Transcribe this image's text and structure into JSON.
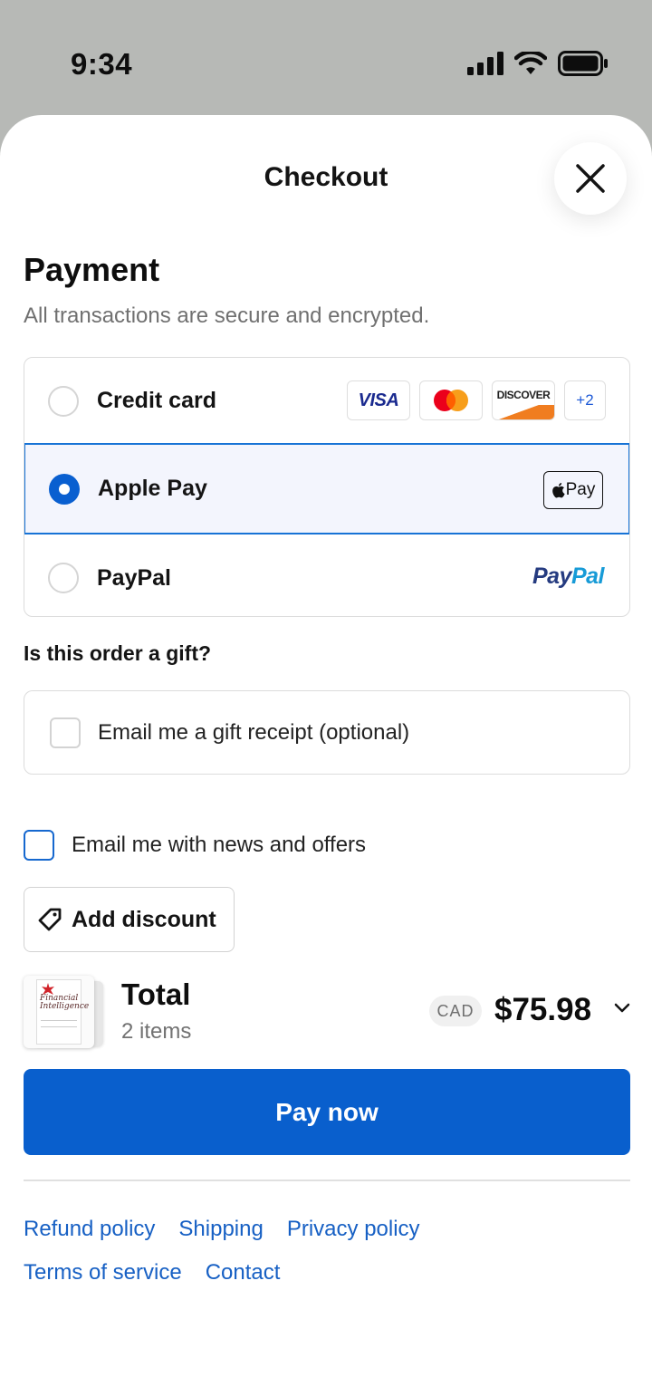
{
  "status_bar": {
    "time": "9:34"
  },
  "sheet": {
    "title": "Checkout"
  },
  "payment": {
    "title": "Payment",
    "subtitle": "All transactions are secure and encrypted.",
    "options": [
      {
        "label": "Credit card",
        "selected": false,
        "card_brands": [
          "VISA",
          "Mastercard",
          "DISCOVER"
        ],
        "more_label": "+2"
      },
      {
        "label": "Apple Pay",
        "selected": true,
        "badge_text": "Pay"
      },
      {
        "label": "PayPal",
        "selected": false,
        "logo_text_1": "Pay",
        "logo_text_2": "Pal"
      }
    ]
  },
  "gift": {
    "question": "Is this order a gift?",
    "receipt_label": "Email me a gift receipt (optional)",
    "receipt_checked": false
  },
  "newsletter": {
    "label": "Email me with news and offers",
    "checked": false
  },
  "discount": {
    "label": "Add discount"
  },
  "summary": {
    "thumbnail_title": "Financial Intelligence",
    "total_label": "Total",
    "items_count": "2 items",
    "currency": "CAD",
    "price": "$75.98"
  },
  "pay_button": {
    "label": "Pay now"
  },
  "footer_links": [
    "Refund policy",
    "Shipping",
    "Privacy policy",
    "Terms of service",
    "Contact"
  ],
  "colors": {
    "primary": "#095fcd",
    "selected_bg": "#f3f5fd",
    "link": "#1760c4",
    "paypal_dark": "#253b80",
    "paypal_light": "#179bd7"
  }
}
